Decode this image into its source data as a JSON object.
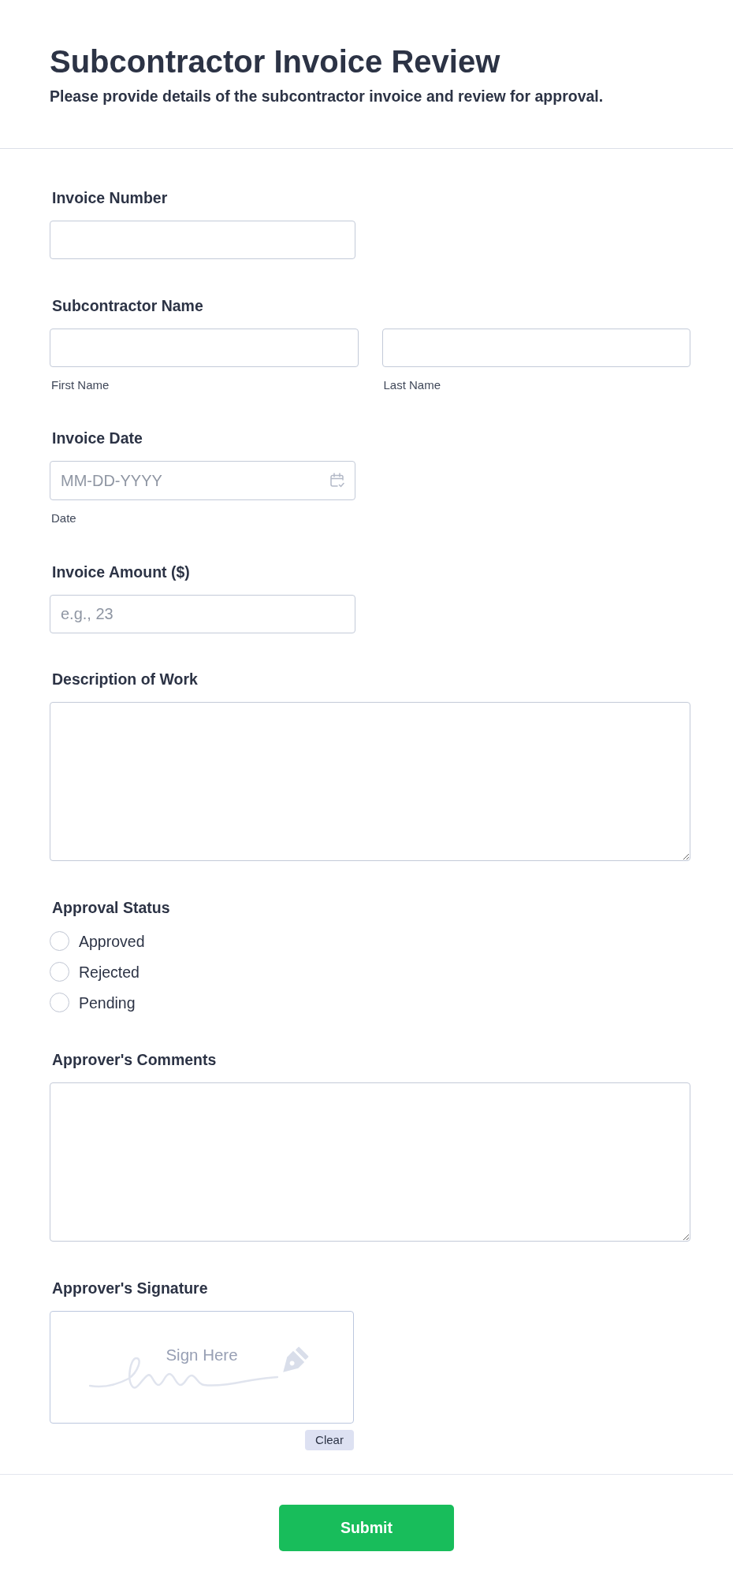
{
  "header": {
    "title": "Subcontractor Invoice Review",
    "subtitle": "Please provide details of the subcontractor invoice and review for approval."
  },
  "fields": [
    {
      "kind": "text",
      "label": "Invoice Number"
    },
    {
      "kind": "name",
      "label": "Subcontractor Name",
      "inputs": [
        {
          "sublabel": "First Name"
        },
        {
          "sublabel": "Last Name"
        }
      ]
    },
    {
      "kind": "date",
      "label": "Invoice Date",
      "placeholder": "MM-DD-YYYY",
      "sublabel": "Date"
    },
    {
      "kind": "number",
      "label": "Invoice Amount ($)",
      "placeholder": "e.g., 23"
    },
    {
      "kind": "textarea",
      "label": "Description of Work"
    },
    {
      "kind": "radio",
      "label": "Approval Status",
      "options": [
        {
          "label": "Approved",
          "selected": false
        },
        {
          "label": "Rejected",
          "selected": false
        },
        {
          "label": "Pending",
          "selected": false
        }
      ]
    },
    {
      "kind": "textarea",
      "label": "Approver's Comments"
    },
    {
      "kind": "signature",
      "label": "Approver's Signature",
      "prompt": "Sign Here",
      "clear_button": "Clear"
    }
  ],
  "submit_button": "Submit"
}
